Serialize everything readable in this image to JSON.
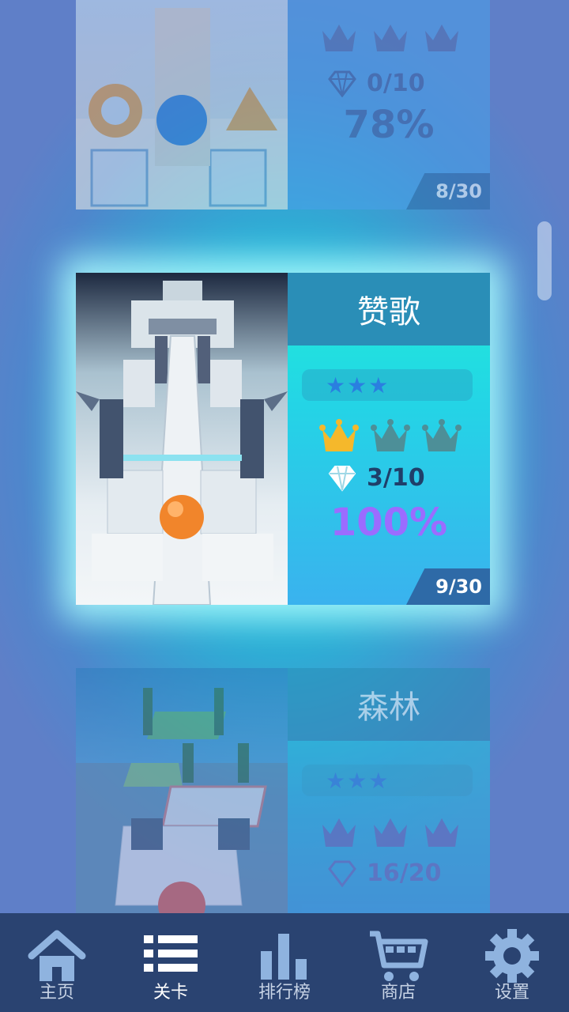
{
  "levels": {
    "prev": {
      "gems": "0/10",
      "percent": "78%",
      "number": "8/30",
      "stars": "★★★"
    },
    "current": {
      "title": "赞歌",
      "stars": "★★★",
      "gems": "3/10",
      "percent": "100%",
      "number": "9/30"
    },
    "next": {
      "title": "森林",
      "stars": "★★★",
      "gems": "16/20"
    }
  },
  "tabs": [
    {
      "label": "主页",
      "icon": "home-icon"
    },
    {
      "label": "关卡",
      "icon": "list-icon"
    },
    {
      "label": "排行榜",
      "icon": "leaderboard-icon"
    },
    {
      "label": "商店",
      "icon": "shop-cart-icon"
    },
    {
      "label": "设置",
      "icon": "gear-icon"
    }
  ],
  "active_tab": "关卡",
  "colors": {
    "crown_gold": "#f5b82b",
    "crown_gray": "#4d8f98",
    "percent_purple": "#9b6cff",
    "tabbar_bg": "#2a4371"
  }
}
